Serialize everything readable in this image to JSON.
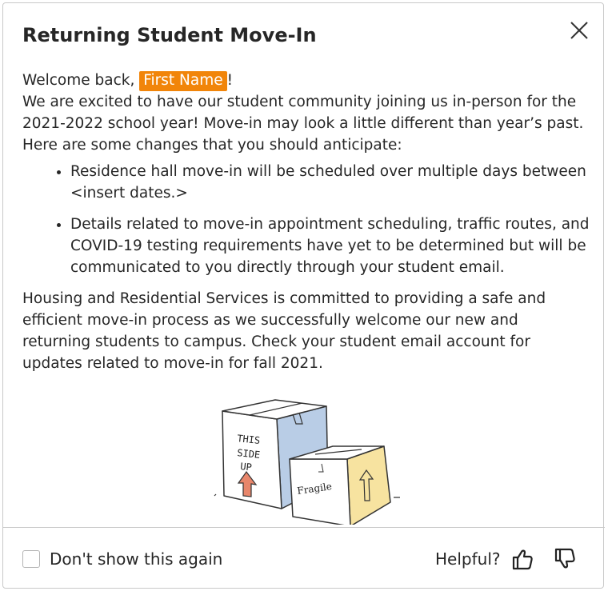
{
  "dialog": {
    "title": "Returning Student Move-In",
    "close_icon": "close-icon"
  },
  "content": {
    "greeting_prefix": "Welcome back, ",
    "name_token": "First Name",
    "greeting_suffix": "!",
    "intro": "We are excited to have our student community joining us in-person for the 2021-2022 school year! Move-in may look a little different than year’s past. Here are some changes that you should anticipate:",
    "bullets": [
      "Residence hall move-in will be scheduled over multiple days between <insert dates.>",
      "Details related to move-in appointment scheduling, traffic routes, and COVID-19 testing requirements have yet to be determined but will be communicated to you directly through your student email."
    ],
    "closing": "Housing and Residential Services is committed to providing a safe and efficient move-in process as we successfully welcome our new and returning students to campus. Check your student email account for updates related to move-in for fall 2021."
  },
  "illustration": {
    "box1_text": [
      "THIS",
      "SIDE",
      "UP"
    ],
    "box2_text": "Fragile",
    "box1_color": "#b9cde6",
    "box2_color": "#f7e3a0",
    "arrow_color": "#e8866b"
  },
  "footer": {
    "dont_show_label": "Don't show this again",
    "dont_show_checked": false,
    "helpful_label": "Helpful?",
    "thumbs_up_icon": "thumbs-up-icon",
    "thumbs_down_icon": "thumbs-down-icon"
  },
  "colors": {
    "highlight": "#f1850a",
    "text": "#262626",
    "border": "#c9c9c9"
  }
}
